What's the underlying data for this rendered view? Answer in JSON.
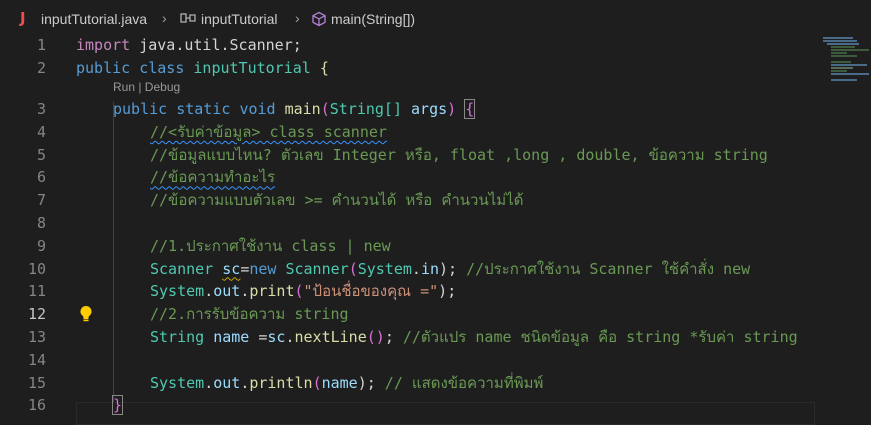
{
  "breadcrumb": {
    "file": "inputTutorial.java",
    "class": "inputTutorial",
    "method": "main(String[])"
  },
  "codelens": "Run | Debug",
  "line_numbers": [
    "1",
    "2",
    "3",
    "4",
    "5",
    "6",
    "7",
    "8",
    "9",
    "10",
    "11",
    "12",
    "13",
    "14",
    "15",
    "16"
  ],
  "active_line": "12",
  "code": {
    "l1": {
      "import": "import",
      "pkg": "java.util.Scanner",
      "semi": ";"
    },
    "l2": {
      "public": "public",
      "class": "class",
      "name": "inputTutorial",
      "brace": "{"
    },
    "l3": {
      "public": "public",
      "static": "static",
      "void": "void",
      "main": "main",
      "open": "(",
      "type": "String[]",
      "args": "args",
      "close": ")",
      "brace": "{"
    },
    "l4": "//<รับค่าข้อมูล> class scanner",
    "l5": "//ข้อมูลแบบไหน? ตัวเลข Integer หรือ, float ,long , double, ข้อความ string",
    "l6": "//ข้อความทำอะไร",
    "l7": "//ข้อความแบบตัวเลข >= คำนวนได้ หรือ คำนวนไม่ได้",
    "l9": "//1.ประกาศใช้งาน class | new",
    "l10": {
      "type": "Scanner",
      "var": "sc",
      "eq": "=",
      "new": "new",
      "ctor": "Scanner",
      "open": "(",
      "sys": "System",
      "dot": ".",
      "in": "in",
      "close": ");",
      "comment": " //ประกาศใช้งาน Scanner ใช้คำสั่ง new"
    },
    "l11": {
      "sys": "System",
      "dot1": ".",
      "out": "out",
      "dot2": ".",
      "print": "print",
      "open": "(",
      "str": "\"ป้อนชื่อของคุณ =\"",
      "close": ");"
    },
    "l12": "//2.การรับข้อความ string",
    "l13": {
      "type": "String",
      "var": "name",
      "eq": " =",
      "sc": "sc",
      "dot": ".",
      "fn": "nextLine",
      "parens": "()",
      "semi": ";",
      "comment": " //ตัวแปร name ชนิดข้อมูล คือ string *รับค่า string"
    },
    "l15": {
      "sys": "System",
      "dot1": ".",
      "out": "out",
      "dot2": ".",
      "fn": "println",
      "open": "(",
      "arg": "name",
      "close": ");",
      "comment": " // แสดงข้อความที่พิมพ์"
    },
    "l16": "}"
  },
  "colors": {
    "background": "#1e1e1e",
    "keyword": "#569cd6",
    "type": "#4ec9b0",
    "function": "#dcdcaa",
    "variable": "#9cdcfe",
    "comment": "#6a9955",
    "string": "#ce9178",
    "java_icon": "#f14c4c"
  }
}
